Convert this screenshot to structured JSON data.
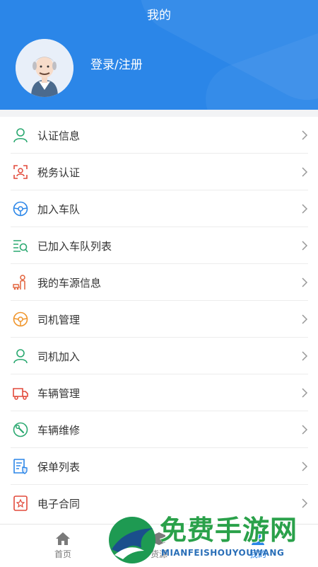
{
  "header": {
    "title": "我的",
    "login_label": "登录/注册"
  },
  "menu": {
    "items": [
      {
        "label": "认证信息"
      },
      {
        "label": "税务认证"
      },
      {
        "label": "加入车队"
      },
      {
        "label": "已加入车队列表"
      },
      {
        "label": "我的车源信息"
      },
      {
        "label": "司机管理"
      },
      {
        "label": "司机加入"
      },
      {
        "label": "车辆管理"
      },
      {
        "label": "车辆维修"
      },
      {
        "label": "保单列表"
      },
      {
        "label": "电子合同"
      }
    ]
  },
  "tabbar": {
    "tabs": [
      {
        "label": "首页"
      },
      {
        "label": "货源"
      },
      {
        "label": "我的"
      }
    ]
  },
  "watermark": {
    "title": "免费手游网",
    "subtitle": "MIANFEISHOUYOUWANG"
  },
  "colors": {
    "header_bg": "#2b86e8",
    "green_icon": "#2aa870",
    "red_icon": "#e24a3b",
    "blue_icon": "#2b86e8",
    "orange_icon": "#f0952b",
    "active_tab": "#2b86e8"
  }
}
